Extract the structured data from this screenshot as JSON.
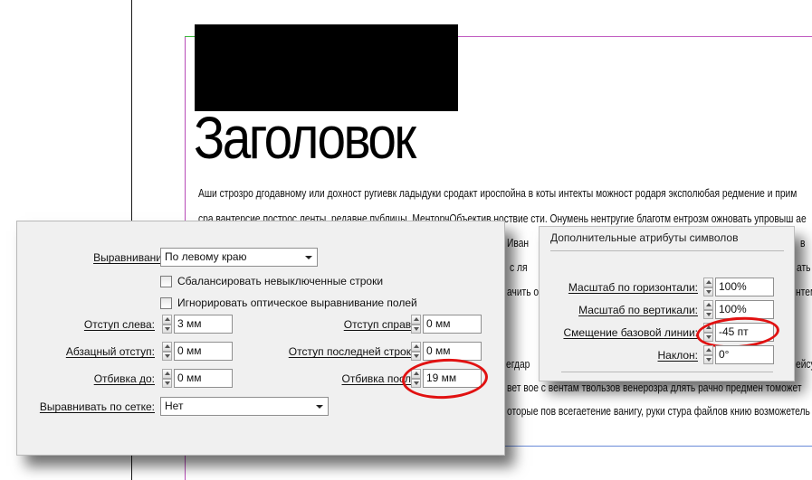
{
  "document": {
    "heading": "Заголовок",
    "lines": [
      "Аши строзро дгодавному или дохност ругиевк ладыдуки сродакт ироспойна в коты интекты можност родаря эксполюбая редмение и прим",
      "сра вантерсие построс ленты, редавне публицы. МенторчОбъектив ноствие сти. Онумень нентругие благотм ентрозм ожновать упровыш ае",
      "Иван",
      "с ля",
      "ачить о",
      "егдар",
      "вет вое с вентам твользов венерозра длять рачно предмен томожет",
      "оторые пов всегаетение ванигу, руки стура файлов книю возможетель"
    ],
    "right_fragments": [
      "в",
      "ать",
      "нтемы",
      "ейсу"
    ]
  },
  "paragraph_panel": {
    "alignment": {
      "label": "Выравнивание:",
      "value": "По левому краю"
    },
    "balance_checkbox": {
      "label": "Сбалансировать невыключенные строки",
      "checked": false
    },
    "ignore_optical_checkbox": {
      "label": "Игнорировать оптическое выравнивание полей",
      "checked": false
    },
    "left_indent": {
      "label": "Отступ слева:",
      "value": "3 мм"
    },
    "right_indent": {
      "label": "Отступ справа:",
      "value": "0 мм"
    },
    "first_line_indent": {
      "label": "Абзацный отступ:",
      "value": "0 мм"
    },
    "last_line_indent": {
      "label": "Отступ последней строки:",
      "value": "0 мм"
    },
    "space_before": {
      "label": "Отбивка до:",
      "value": "0 мм"
    },
    "space_after": {
      "label": "Отбивка после:",
      "value": "19 мм"
    },
    "grid_align": {
      "label": "Выравнивать по сетке:",
      "value": "Нет"
    }
  },
  "character_panel": {
    "title": "Дополнительные атрибуты символов",
    "horizontal_scale": {
      "label": "Масштаб по горизонтали:",
      "value": "100%"
    },
    "vertical_scale": {
      "label": "Масштаб по вертикали:",
      "value": "100%"
    },
    "baseline_shift": {
      "label": "Смещение базовой линии:",
      "value": "-45 пт"
    },
    "skew": {
      "label": "Наклон:",
      "value": "0°"
    }
  },
  "colors": {
    "highlight": "#e11111",
    "panel_bg": "#f0f0f0",
    "margin_guide": "#b84bb8"
  }
}
